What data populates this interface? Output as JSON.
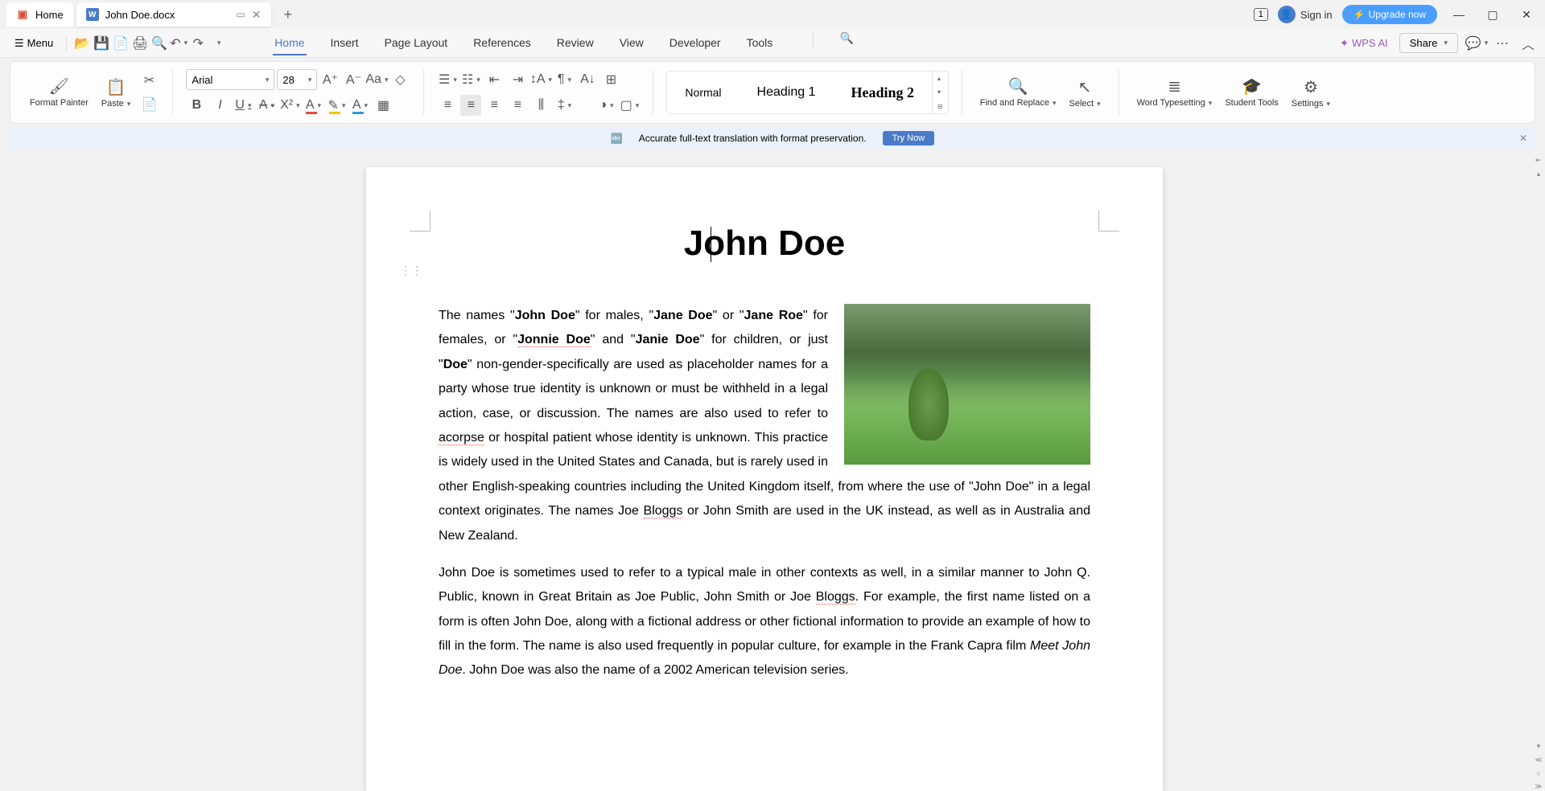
{
  "titlebar": {
    "home_tab": "Home",
    "doc_tab": "John Doe.docx",
    "badge": "1",
    "signin": "Sign in",
    "upgrade": "Upgrade now"
  },
  "menubar": {
    "menu_label": "Menu",
    "tabs": [
      "Home",
      "Insert",
      "Page Layout",
      "References",
      "Review",
      "View",
      "Developer",
      "Tools"
    ],
    "wps_ai": "WPS AI",
    "share": "Share"
  },
  "ribbon": {
    "format_painter": "Format Painter",
    "paste": "Paste",
    "font_name": "Arial",
    "font_size": "28",
    "styles": {
      "normal": "Normal",
      "h1": "Heading 1",
      "h2": "Heading 2"
    },
    "find_replace": "Find and Replace",
    "select": "Select",
    "word_typesetting": "Word Typesetting",
    "student_tools": "Student Tools",
    "settings": "Settings"
  },
  "banner": {
    "text": "Accurate full-text translation with format preservation.",
    "try_now": "Try Now"
  },
  "document": {
    "title": "John Doe",
    "p1_parts": {
      "t1": "The names \"",
      "b1": "John Doe",
      "t2": "\" for males, \"",
      "b2": "Jane Doe",
      "t3": "\" or \"",
      "b3": "Jane Roe",
      "t4": "\" for females, or \"",
      "b4": "Jonnie Doe",
      "t5": "\" and \"",
      "b5": "Janie Doe",
      "t6": "\" for children, or just \"",
      "b6": "Doe",
      "t7": "\" non-gender-specifically are used as placeholder names for a party whose true identity is unknown or must be withheld in a legal action, case, or discussion. The names are also used to refer to ",
      "u1": "acorpse",
      "t8": " or hospital patient whose identity is unknown. This practice is widely used in the United States and Canada, but is rarely used in other English-speaking countries including the United Kingdom itself, from where the use of \"John Doe\" in a legal context originates. The names Joe ",
      "u2": "Bloggs",
      "t9": " or John Smith are used in the UK instead, as well as in Australia and New Zealand."
    },
    "p2_parts": {
      "t1": "John Doe is sometimes used to refer to a typical male in other contexts as well, in a similar manner to John Q. Public, known in Great Britain as Joe Public, John Smith or Joe ",
      "u1": "Bloggs",
      "t2": ". For example, the first name listed on a form is often John Doe, along with a fictional address or other fictional information to provide an example of how to fill in the form. The name is also used frequently in popular culture, for example in the Frank Capra film ",
      "i1": "Meet John Doe",
      "t3": ". John Doe was also the name of a 2002 American television series."
    }
  }
}
